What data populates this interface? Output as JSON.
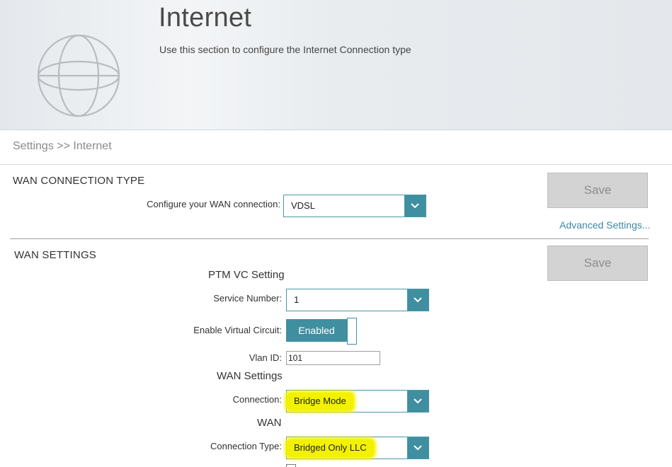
{
  "header": {
    "title": "Internet",
    "subtitle": "Use this section to configure the Internet Connection type",
    "icon": "globe-icon"
  },
  "breadcrumb": "Settings >> Internet",
  "wan_connection_type": {
    "heading": "WAN CONNECTION TYPE",
    "configure_label": "Configure your WAN connection:",
    "configure_value": "VDSL",
    "save_label": "Save",
    "advanced_link": "Advanced Settings..."
  },
  "wan_settings": {
    "heading": "WAN SETTINGS",
    "save_label": "Save",
    "ptm_heading": "PTM VC Setting",
    "service_number_label": "Service Number:",
    "service_number_value": "1",
    "enable_vc_label": "Enable Virtual Circuit:",
    "enable_vc_value": "Enabled",
    "vlan_label": "Vlan ID:",
    "vlan_value": "101",
    "wan_settings_heading": "WAN Settings",
    "connection_label": "Connection:",
    "connection_value": "Bridge Mode",
    "wan_heading": "WAN",
    "connection_type_label": "Connection Type:",
    "connection_type_value": "Bridged Only LLC"
  },
  "colors": {
    "accent": "#3f8fa0",
    "link": "#3d88a6",
    "highlight": "#f2f200",
    "button_disabled": "#d3d3d3"
  }
}
